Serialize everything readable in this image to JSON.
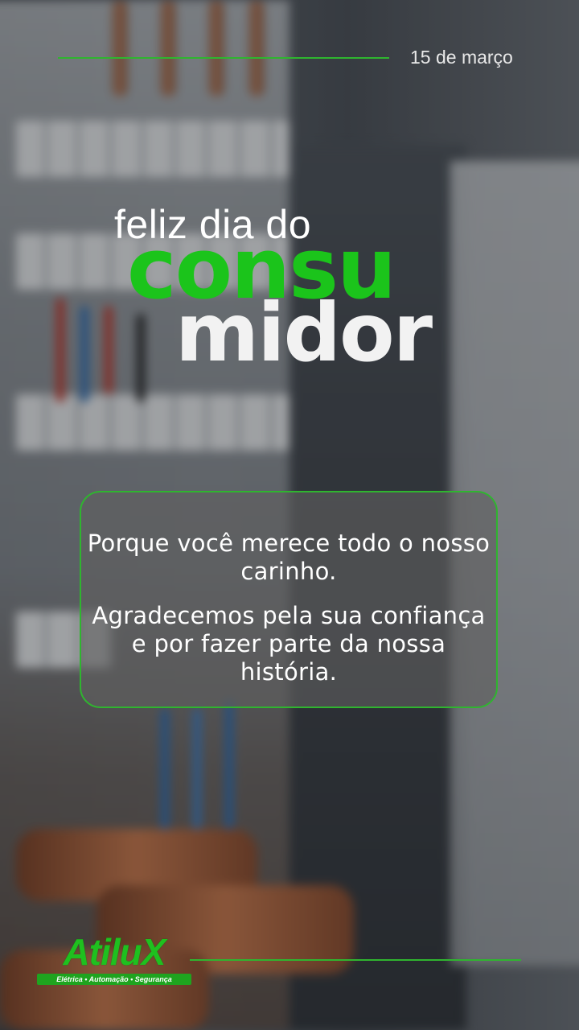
{
  "header": {
    "date": "15 de março"
  },
  "headline": {
    "line1": "feliz dia do",
    "line2": "consu",
    "line3": "midor"
  },
  "message": {
    "paragraph1": "Porque você merece todo o nosso carinho.",
    "paragraph2": "Agradecemos pela sua confiança e por fazer parte da nossa história."
  },
  "brand": {
    "name": "AtiluX",
    "tagline": "Elétrica • Automação • Segurança"
  },
  "colors": {
    "accent_green": "#1bc41b",
    "line_green": "#2fb52f",
    "text_white": "#ffffff"
  },
  "background": {
    "description_icon": "electrical-panel-photo"
  }
}
